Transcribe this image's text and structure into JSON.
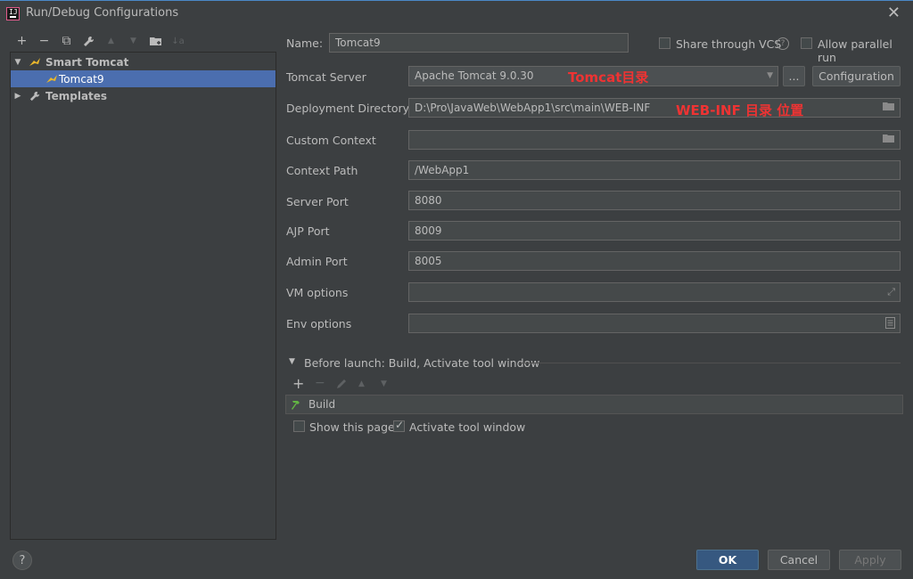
{
  "window": {
    "title": "Run/Debug Configurations",
    "app_icon_text": "IJ"
  },
  "toolbar": {
    "add": "+",
    "remove": "−",
    "copy": "⧉",
    "edit": "🔧",
    "up": "▲",
    "down": "▼",
    "folder": "📁",
    "sort": "↓a"
  },
  "tree": [
    {
      "label": "Smart Tomcat",
      "bold": true,
      "expanded": true
    },
    {
      "label": "Tomcat9",
      "selected": true
    },
    {
      "label": "Templates",
      "bold": true,
      "expanded": false
    }
  ],
  "form": {
    "name_label": "Name:",
    "name_value": "Tomcat9",
    "share_vcs": "Share through VCS",
    "allow_parallel": "Allow parallel run",
    "tomcat_server_label": "Tomcat Server",
    "tomcat_server_value": "Apache Tomcat 9.0.30",
    "browse_button": "...",
    "configuration_button": "Configuration",
    "deployment_dir_label": "Deployment Directory",
    "deployment_dir_value": "D:\\Pro\\JavaWeb\\WebApp1\\src\\main\\WEB-INF",
    "custom_context_label": "Custom Context",
    "custom_context_value": "",
    "context_path_label": "Context Path",
    "context_path_value": "/WebApp1",
    "server_port_label": "Server Port",
    "server_port_value": "8080",
    "ajp_port_label": "AJP Port",
    "ajp_port_value": "8009",
    "admin_port_label": "Admin Port",
    "admin_port_value": "8005",
    "vm_options_label": "VM options",
    "vm_options_value": "",
    "env_options_label": "Env options",
    "env_options_value": ""
  },
  "annotations": {
    "tomcat_dir": "Tomcat目录",
    "webinf_dir": "WEB-INF 目录 位置"
  },
  "before_launch": {
    "title": "Before launch: Build, Activate tool window",
    "tasks": [
      "Build"
    ],
    "show_this_page": "Show this page",
    "activate_tool_window": "Activate tool window"
  },
  "buttons": {
    "ok": "OK",
    "cancel": "Cancel",
    "apply": "Apply",
    "help": "?"
  },
  "colors": {
    "background": "#3c3f41",
    "selection": "#4b6eaf",
    "primary_button": "#365880",
    "annotation": "#ee3333"
  }
}
